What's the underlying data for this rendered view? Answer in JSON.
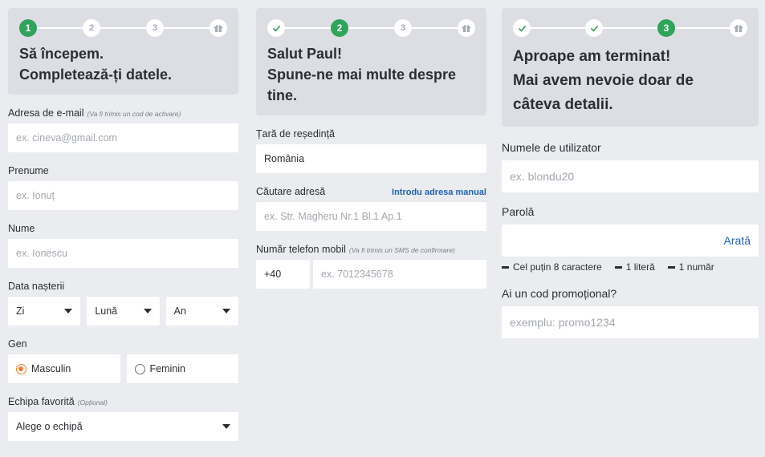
{
  "step1": {
    "steps": [
      "1",
      "2",
      "3"
    ],
    "title_line1": "Să începem.",
    "title_line2": "Completează-ți datele.",
    "email": {
      "label": "Adresa de e-mail",
      "hint": "(Va fi trimis un cod de activare)",
      "placeholder": "ex. cineva@gmail.com"
    },
    "first_name": {
      "label": "Prenume",
      "placeholder": "ex. Ionuț"
    },
    "last_name": {
      "label": "Nume",
      "placeholder": "ex. Ionescu"
    },
    "birth_date": {
      "label": "Data nașterii",
      "day": "Zi",
      "month": "Lună",
      "year": "An"
    },
    "gender": {
      "label": "Gen",
      "male": "Masculin",
      "female": "Feminin",
      "selected": "male"
    },
    "team": {
      "label": "Echipa favorită",
      "hint": "(Opțional)",
      "value": "Alege o echipă"
    }
  },
  "step2": {
    "steps": [
      "2",
      "3"
    ],
    "title_line1": "Salut Paul!",
    "title_line2": "Spune-ne mai multe despre tine.",
    "country": {
      "label": "Țară de reședință",
      "value": "România"
    },
    "address": {
      "label": "Căutare adresă",
      "link": "Introdu adresa manual",
      "placeholder": "ex. Str. Magheru Nr.1 Bl.1 Ap.1"
    },
    "phone": {
      "label": "Număr telefon mobil",
      "hint": "(Va fi trimis un SMS de confirmare)",
      "prefix": "+40",
      "placeholder": "ex. 7012345678"
    }
  },
  "step3": {
    "steps": [
      "3"
    ],
    "title_line1": "Aproape am terminat!",
    "title_line2": "Mai avem nevoie doar de",
    "title_line3": "câteva detalii.",
    "username": {
      "label": "Numele de utilizator",
      "placeholder": "ex. blondu20"
    },
    "password": {
      "label": "Parolă",
      "show": "Arată",
      "rules": [
        "Cel puțin 8 caractere",
        "1 literă",
        "1 număr"
      ]
    },
    "promo": {
      "label": "Ai un cod promoțional?",
      "placeholder": "exemplu: promo1234"
    }
  },
  "colors": {
    "accent_green": "#2fa45a",
    "link_blue": "#1f63b5",
    "radio_orange": "#f07a2c"
  },
  "icons": [
    "check-icon",
    "gift-icon",
    "caret-down-icon",
    "radio-icon"
  ]
}
